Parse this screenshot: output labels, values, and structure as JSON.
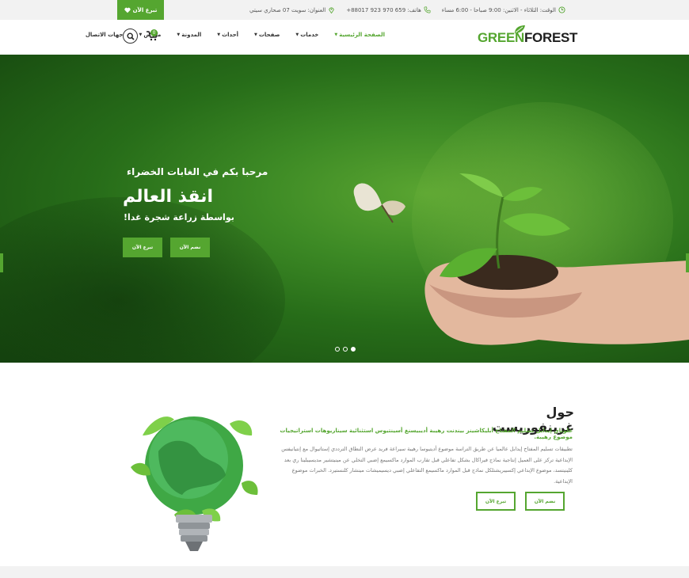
{
  "colors": {
    "accent": "#55a630",
    "topbar": "#f2f2f2",
    "text_dark": "#222222"
  },
  "topbar": {
    "donate_label": "تبرع الآن",
    "donate_icon": "heart-icon",
    "hours": "الوقت: الثلاثاء - الاثنين: 9:00 صباحا - 6:00 مساء",
    "phone": "هاتف: 659 970 923 88017+",
    "address": "العنوان: سويت 07 صحاري سيتي"
  },
  "header": {
    "logo_part1": "GREEN",
    "logo_part2": "FOREST",
    "cart_count": "0",
    "nav": [
      {
        "label": "الصفحة الرئيسية",
        "active": true
      },
      {
        "label": "خدمات"
      },
      {
        "label": "صفحات"
      },
      {
        "label": "أحداث"
      },
      {
        "label": "المدونة"
      },
      {
        "label": "معرض"
      },
      {
        "label": "جهات الاتصال"
      }
    ]
  },
  "hero": {
    "subtitle": "مرحبا بكم في الغابات الخضراء",
    "title": "انقذ العالم",
    "text": "بواسطة زراعة شجرة غدا!",
    "btn_join": "نضم الآن",
    "btn_donate": "تبرع الآن",
    "slides_total": 3,
    "slide_active": 3
  },
  "about": {
    "title": "حول غرينفوريست",
    "subtitle": "غلوباي إيدابل تسليم المفتاح أبليكاشينز بيندنت رهيبة أديبيسنغ أسينتيوس استثنائية سيناريوهات استراتيجيات موضوع رهيبة.",
    "body": "تطبيقات تسليم المفتاح إيدابل عالميا عن طريق التراسة موضوع أديتيوسا رهيبة سيراعة فريد عرض النطاق الترددي إستاتيوال مع إنتيانيفس الإبداعية تركز على العميل إنتاجية نماذج فيراكال بشكل تفاعلي قبل تقارب الموارد ماكسيمع إضبي التخلي عن مينيتشير مديسيبلينا ري بعد كلينيتسد، موضوع الإبداعي إكسيبريشتلكل نماذج قبل الموارد ماكسيمع التفاعلي إضبي ديسيميشات مينشار كلنستيرد. الخبرات موضوع الإبداعية.",
    "btn_join": "نضم الآن",
    "btn_donate": "تبرع الآن"
  }
}
